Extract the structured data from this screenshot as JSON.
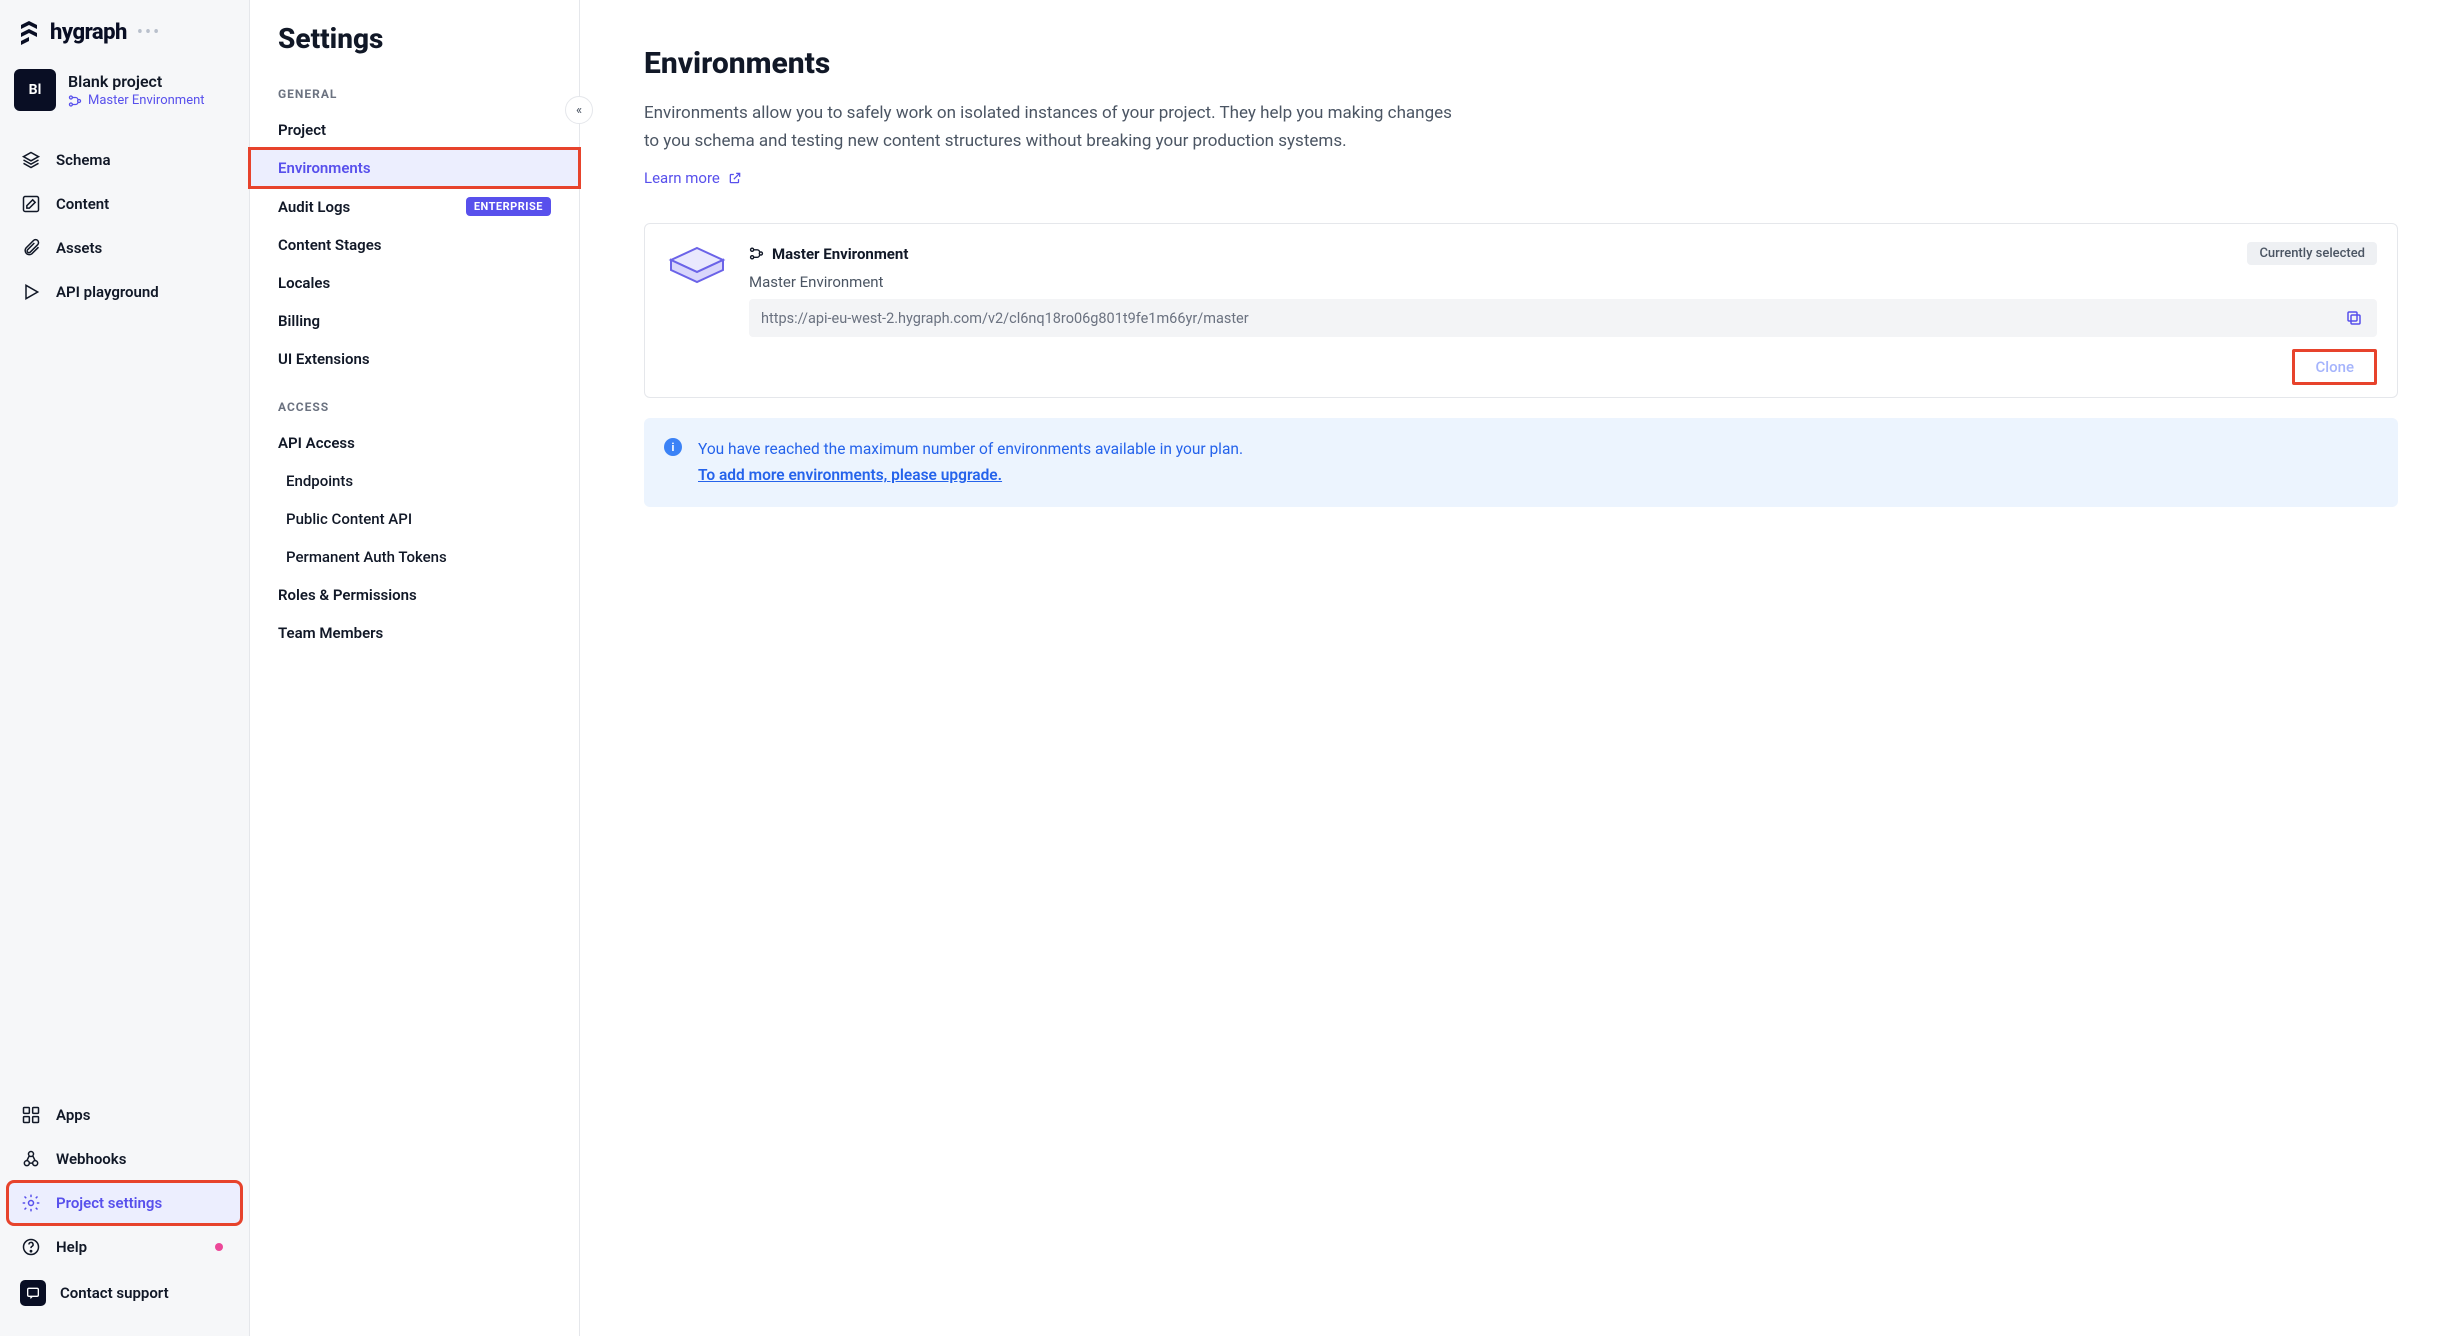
{
  "brand": {
    "name": "hygraph"
  },
  "project": {
    "avatar": "Bl",
    "name": "Blank project",
    "env_label": "Master Environment"
  },
  "nav": {
    "top": [
      {
        "id": "schema",
        "label": "Schema"
      },
      {
        "id": "content",
        "label": "Content"
      },
      {
        "id": "assets",
        "label": "Assets"
      },
      {
        "id": "playground",
        "label": "API playground"
      }
    ],
    "bottom": [
      {
        "id": "apps",
        "label": "Apps"
      },
      {
        "id": "webhooks",
        "label": "Webhooks"
      },
      {
        "id": "project-settings",
        "label": "Project settings",
        "active": true
      },
      {
        "id": "help",
        "label": "Help",
        "dot": true
      },
      {
        "id": "contact",
        "label": "Contact support"
      }
    ]
  },
  "settings": {
    "title": "Settings",
    "groups": {
      "general": {
        "label": "GENERAL",
        "items": [
          {
            "id": "project",
            "label": "Project"
          },
          {
            "id": "environments",
            "label": "Environments",
            "active": true
          },
          {
            "id": "audit-logs",
            "label": "Audit Logs",
            "badge": "ENTERPRISE"
          },
          {
            "id": "content-stages",
            "label": "Content Stages"
          },
          {
            "id": "locales",
            "label": "Locales"
          },
          {
            "id": "billing",
            "label": "Billing"
          },
          {
            "id": "ui-extensions",
            "label": "UI Extensions"
          }
        ]
      },
      "access": {
        "label": "ACCESS",
        "items": [
          {
            "id": "api-access",
            "label": "API Access"
          },
          {
            "id": "endpoints",
            "label": "Endpoints",
            "sub": true
          },
          {
            "id": "public-content-api",
            "label": "Public Content API",
            "sub": true
          },
          {
            "id": "permanent-auth-tokens",
            "label": "Permanent Auth Tokens",
            "sub": true
          },
          {
            "id": "roles-permissions",
            "label": "Roles & Permissions"
          },
          {
            "id": "team-members",
            "label": "Team Members"
          }
        ]
      }
    }
  },
  "main": {
    "title": "Environments",
    "description": "Environments allow you to safely work on isolated instances of your project. They help you making changes to you schema and testing new content structures without breaking your production systems.",
    "learn_more": "Learn more",
    "env": {
      "name": "Master Environment",
      "label": "Master Environment",
      "status": "Currently selected",
      "url": "https://api-eu-west-2.hygraph.com/v2/cl6nq18ro06g801t9fe1m66yr/master",
      "clone": "Clone"
    },
    "info": {
      "line1": "You have reached the maximum number of environments available in your plan.",
      "upgrade": "To add more environments, please upgrade."
    }
  }
}
